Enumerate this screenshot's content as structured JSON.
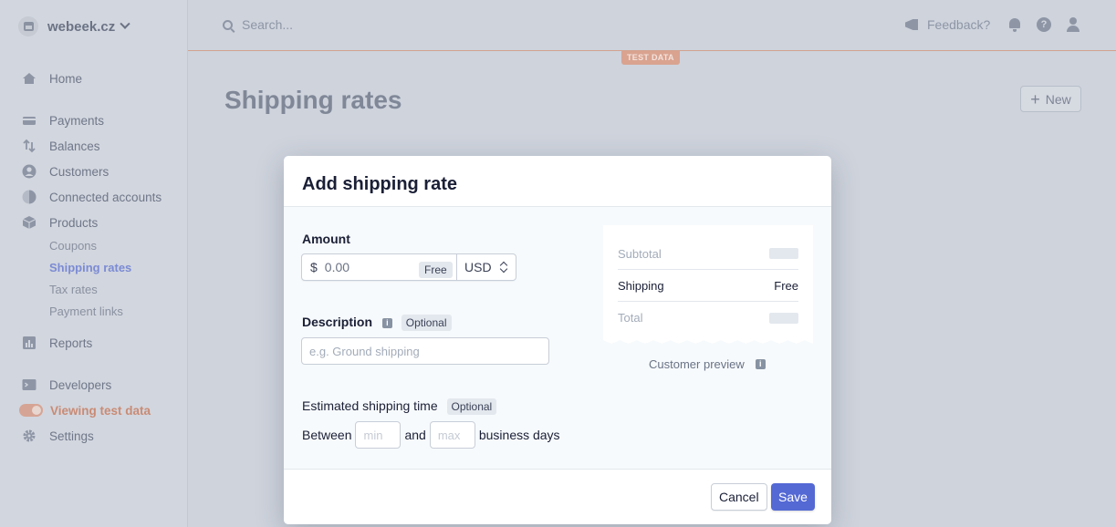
{
  "account": {
    "name": "webeek.cz"
  },
  "sidebar": {
    "home": "Home",
    "payments": "Payments",
    "balances": "Balances",
    "customers": "Customers",
    "connected_accounts": "Connected accounts",
    "products": "Products",
    "sub_items": [
      "Coupons",
      "Shipping rates",
      "Tax rates",
      "Payment links"
    ],
    "reports": "Reports",
    "developers": "Developers",
    "viewing_test_data": "Viewing test data",
    "settings": "Settings"
  },
  "topbar": {
    "search_placeholder": "Search...",
    "feedback": "Feedback?",
    "help_glyph": "?"
  },
  "test_data_badge": "TEST DATA",
  "page": {
    "title": "Shipping rates",
    "new_button": "New"
  },
  "modal": {
    "title": "Add shipping rate",
    "amount": {
      "label": "Amount",
      "currency_symbol": "$",
      "value": "0.00",
      "free_badge": "Free",
      "currency": "USD"
    },
    "description": {
      "label": "Description",
      "optional": "Optional",
      "placeholder": "e.g. Ground shipping"
    },
    "estimated": {
      "label": "Estimated shipping time",
      "optional": "Optional",
      "between": "Between",
      "min_placeholder": "min",
      "and": "and",
      "max_placeholder": "max",
      "suffix": "business days"
    },
    "preview": {
      "subtotal": "Subtotal",
      "shipping": "Shipping",
      "shipping_value": "Free",
      "total": "Total",
      "caption": "Customer preview"
    },
    "info_glyph": "i",
    "cancel": "Cancel",
    "save": "Save"
  },
  "colors": {
    "primary": "#5469d4",
    "test_mode": "#d9a390",
    "overlay": "#ced3dc"
  },
  "icons": [
    "store-icon",
    "chevron-down-icon",
    "home-icon",
    "payments-icon",
    "balances-icon",
    "customers-icon",
    "connected-accounts-icon",
    "products-icon",
    "reports-icon",
    "developers-icon",
    "gear-icon",
    "search-icon",
    "megaphone-icon",
    "bell-icon",
    "help-icon",
    "user-icon",
    "plus-icon",
    "info-icon",
    "select-arrows-icon"
  ]
}
